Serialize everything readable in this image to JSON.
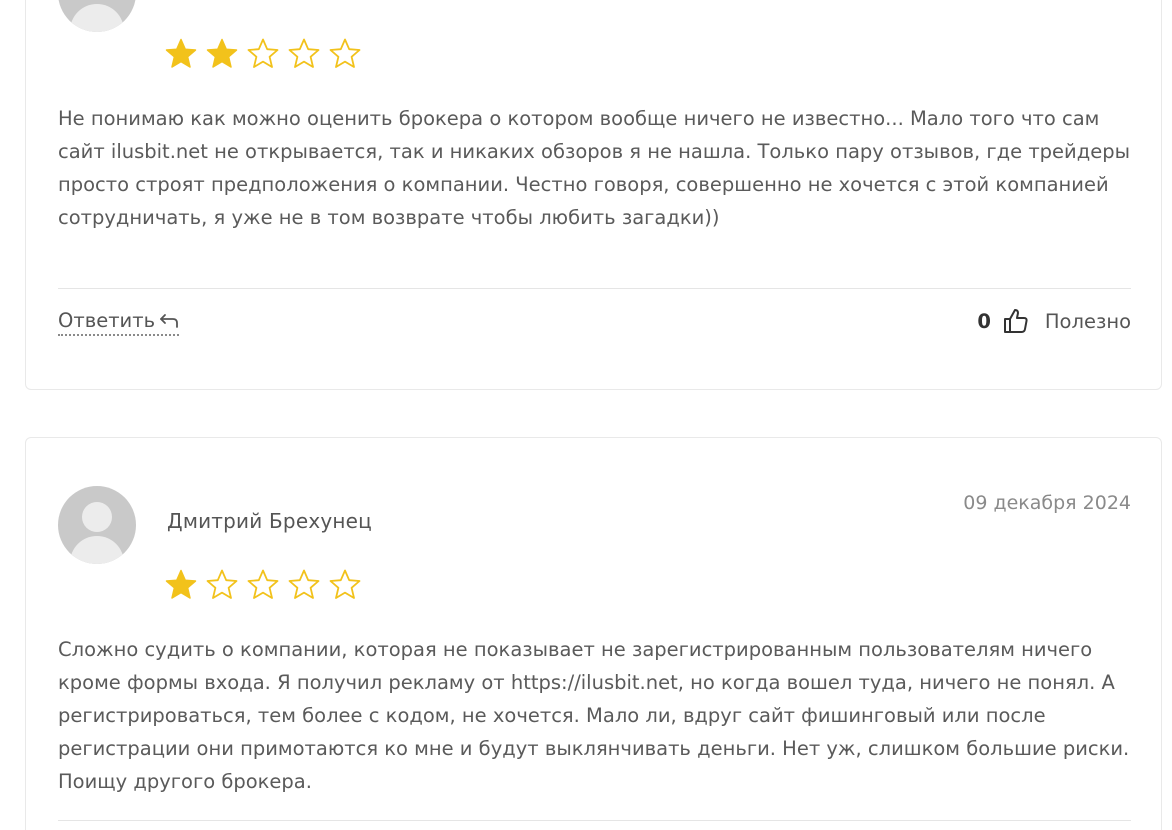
{
  "reviews": [
    {
      "author": "",
      "date": "",
      "rating": 2,
      "max_rating": 5,
      "text": "Не понимаю как можно оценить брокера о котором вообще ничего не известно... Мало того что сам сайт ilusbit.net не открывается, так и никаких обзоров я не нашла. Только пару отзывов, где трейдеры просто строят предположения о компании. Честно говоря, совершенно не хочется с этой компанией сотрудничать, я уже не в том возврате чтобы любить загадки))",
      "reply_label": "Ответить",
      "useful_count": "0",
      "useful_label": "Полезно"
    },
    {
      "author": "Дмитрий Брехунец",
      "date": "09 декабря 2024",
      "rating": 1,
      "max_rating": 5,
      "text": "Сложно судить о компании, которая не показывает не зарегистрированным пользователям ничего кроме формы входа. Я получил рекламу от https://ilusbit.net, но когда вошел туда, ничего не понял. А регистрироваться, тем более с кодом, не хочется. Мало ли, вдруг сайт фишинговый или после регистрации они примотаются ко мне и будут выклянчивать деньги. Нет уж, слишком большие риски. Поищу другого брокера."
    }
  ],
  "colors": {
    "star_filled": "#f2c21b",
    "star_empty_stroke": "#f2c21b",
    "text": "#5a5a5a",
    "border": "#e9e9e9"
  },
  "icons": {
    "reply": "reply-arrow-icon",
    "useful": "thumbs-up-icon",
    "avatar": "user-placeholder-icon"
  }
}
